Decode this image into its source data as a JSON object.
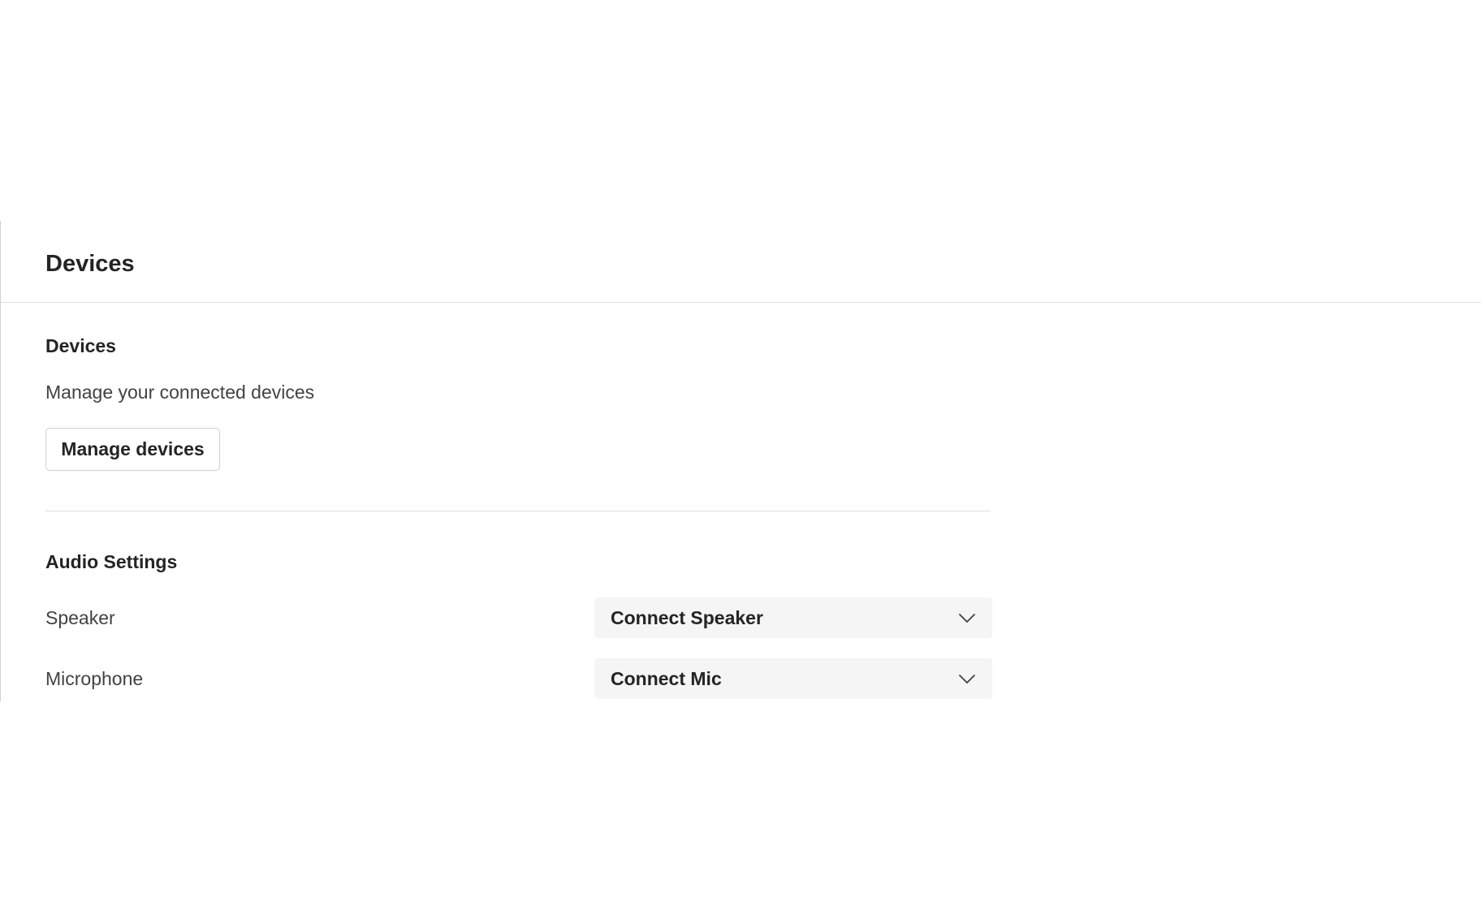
{
  "header": {
    "title": "Devices"
  },
  "devices_section": {
    "title": "Devices",
    "description": "Manage your connected devices",
    "manage_button_label": "Manage devices"
  },
  "audio_section": {
    "title": "Audio Settings",
    "speaker": {
      "label": "Speaker",
      "selected_value": "Connect Speaker",
      "icon": "chevron-down-icon"
    },
    "microphone": {
      "label": "Microphone",
      "selected_value": "Connect Mic",
      "icon": "chevron-down-icon"
    }
  },
  "colors": {
    "text_primary": "#242424",
    "text_secondary": "#424242",
    "dropdown_background": "#f5f5f5",
    "divider": "#e0e0e0"
  }
}
